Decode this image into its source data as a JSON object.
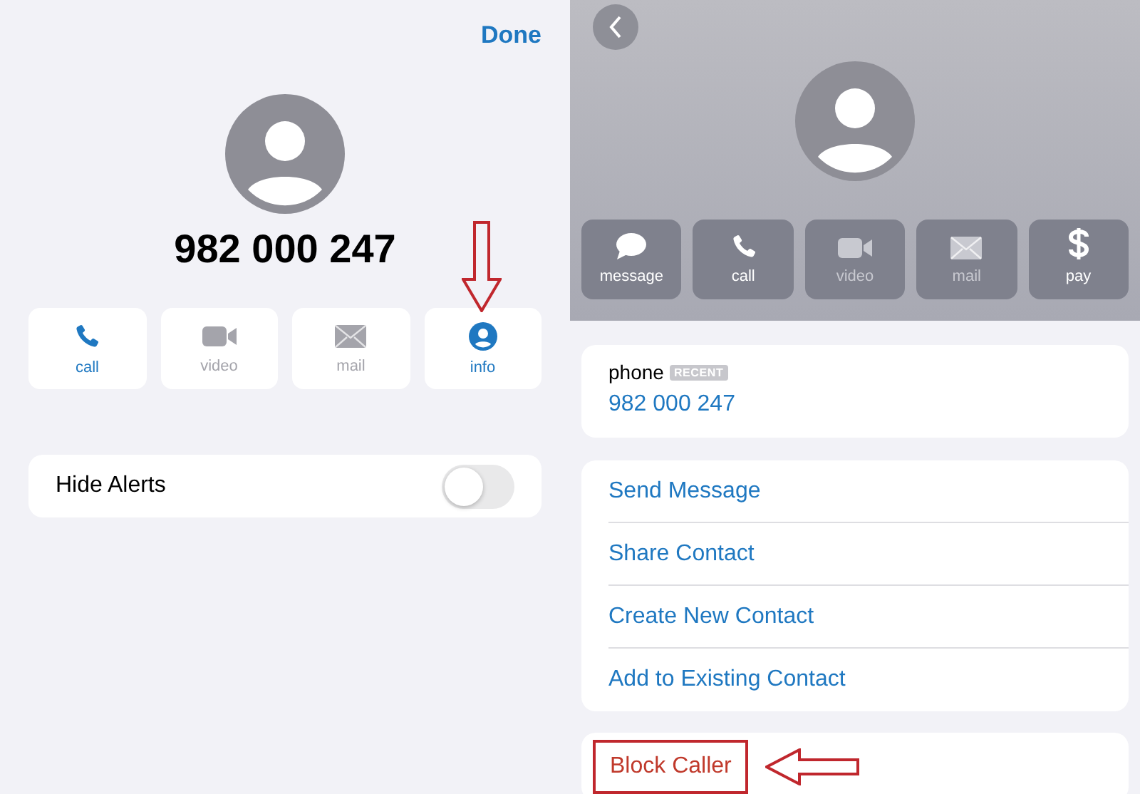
{
  "call_screen": {
    "done_button": "Done",
    "number": "982 000 247",
    "actions": [
      {
        "kind": "phone",
        "label": "call",
        "disabled": false
      },
      {
        "kind": "video",
        "label": "video",
        "disabled": true
      },
      {
        "kind": "mail",
        "label": "mail",
        "disabled": true
      },
      {
        "kind": "info",
        "label": "info",
        "disabled": false
      }
    ],
    "hide_alerts": {
      "label": "Hide Alerts",
      "on": false
    }
  },
  "contact_screen": {
    "actions": [
      {
        "kind": "message",
        "label": "message",
        "disabled": false
      },
      {
        "kind": "phone",
        "label": "call",
        "disabled": false
      },
      {
        "kind": "video",
        "label": "video",
        "disabled": true
      },
      {
        "kind": "mail",
        "label": "mail",
        "disabled": true
      },
      {
        "kind": "pay",
        "label": "pay",
        "disabled": false
      }
    ],
    "phone": {
      "label": "phone",
      "badge": "RECENT",
      "number": "982 000 247"
    },
    "options": [
      {
        "label": "Send Message"
      },
      {
        "label": "Share Contact"
      },
      {
        "label": "Create New Contact"
      },
      {
        "label": "Add to Existing Contact"
      }
    ],
    "danger_options": [
      {
        "label": "Block Caller",
        "highlighted": true
      }
    ]
  }
}
